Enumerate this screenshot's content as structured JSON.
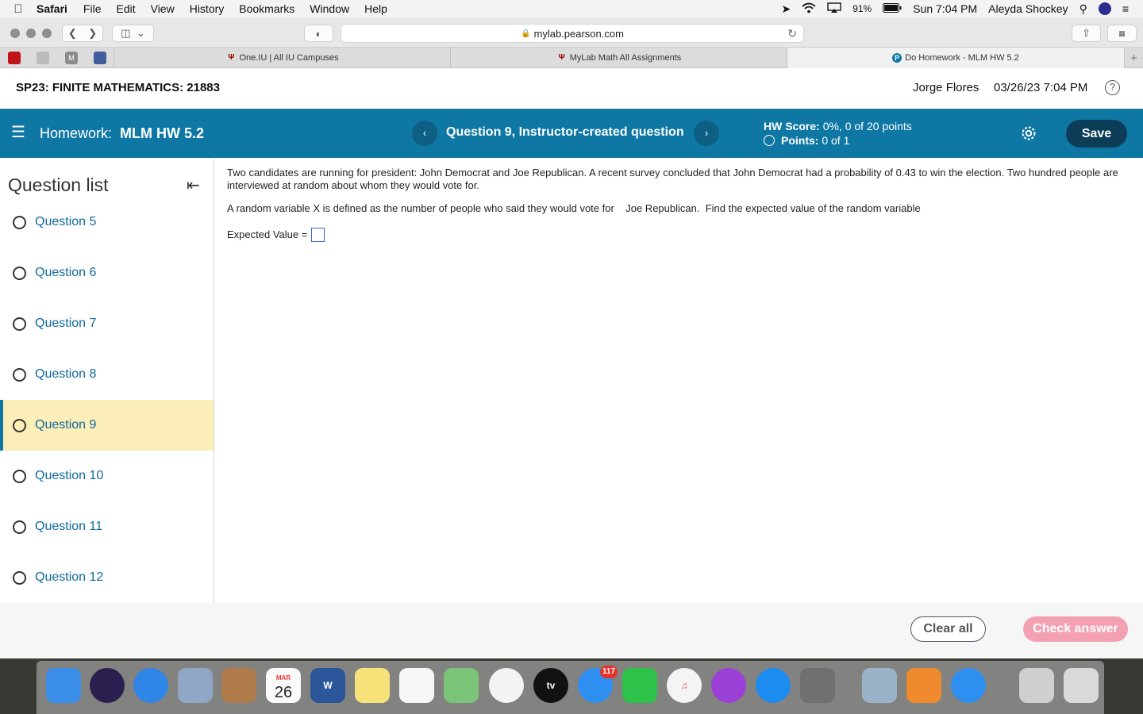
{
  "menubar": {
    "app": "Safari",
    "items": [
      "File",
      "Edit",
      "View",
      "History",
      "Bookmarks",
      "Window",
      "Help"
    ],
    "battery": "91%",
    "clock": "Sun 7:04 PM",
    "user": "Aleyda Shockey"
  },
  "browser": {
    "url": "mylab.pearson.com",
    "tabs": [
      {
        "label": "One.IU | All IU Campuses"
      },
      {
        "label": "MyLab Math All Assignments"
      },
      {
        "label": "Do Homework - MLM HW 5.2"
      }
    ],
    "new_tab": "+"
  },
  "course": {
    "title": "SP23: FINITE MATHEMATICS: 21883",
    "student": "Jorge Flores",
    "datetime": "03/26/23 7:04 PM",
    "help": "?"
  },
  "homework": {
    "prefix": "Homework:",
    "name": "MLM HW 5.2",
    "prev": "‹",
    "next": "›",
    "question_title": "Question 9, Instructor-created question",
    "hw_score_label": "HW Score:",
    "hw_score_value": "0%, 0 of 20 points",
    "points_label": "Points:",
    "points_value": "0 of 1",
    "save": "Save"
  },
  "sidebar": {
    "heading": "Question list",
    "questions": [
      {
        "label": "Question 5"
      },
      {
        "label": "Question 6"
      },
      {
        "label": "Question 7"
      },
      {
        "label": "Question 8"
      },
      {
        "label": "Question 9"
      },
      {
        "label": "Question 10"
      },
      {
        "label": "Question 11"
      },
      {
        "label": "Question 12"
      }
    ],
    "active_index": 4
  },
  "question": {
    "paragraph1": "Two candidates are running for president: John Democrat and Joe Republican. A recent survey concluded that John Democrat had a probability of 0.43 to win the election.  Two hundred  people are interviewed at random about whom they would vote for.",
    "paragraph2": "A random variable X is defined as the number of people who said they would vote for    Joe Republican.  Find the expected value of the random variable",
    "answer_label": "Expected Value =",
    "answer_value": ""
  },
  "footer": {
    "clear_all": "Clear all",
    "check_answer": "Check answer"
  },
  "dock": {
    "calendar_month": "MAR",
    "calendar_day": "26",
    "tv_label": "tv",
    "messages_badge": "117"
  },
  "colors": {
    "hw_bar": "#0f77a4",
    "save_button": "#0b3d58",
    "active_question": "#fbeeb8",
    "question_link": "#0f6a9c",
    "check_answer": "#f3a0b3"
  }
}
